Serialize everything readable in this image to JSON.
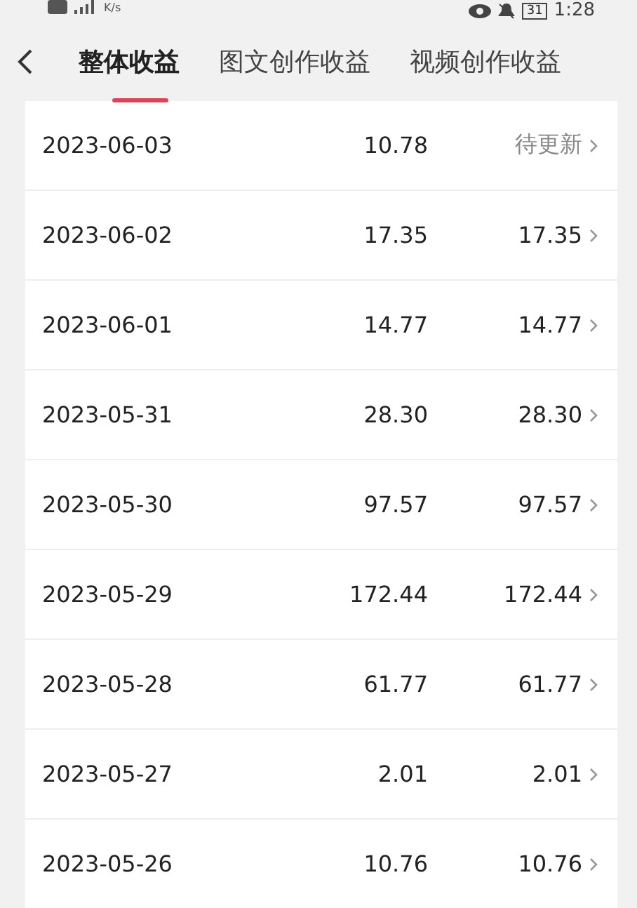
{
  "status_bar": {
    "speed_unit": "K/s",
    "battery": "31",
    "time": "1:28"
  },
  "tabs": [
    {
      "label": "整体收益",
      "selected": true
    },
    {
      "label": "图文创作收益",
      "selected": false
    },
    {
      "label": "视频创作收益",
      "selected": false
    }
  ],
  "rows": [
    {
      "date": "2023-06-03",
      "total": "10.78",
      "settled": "待更新",
      "pending": true
    },
    {
      "date": "2023-06-02",
      "total": "17.35",
      "settled": "17.35",
      "pending": false
    },
    {
      "date": "2023-06-01",
      "total": "14.77",
      "settled": "14.77",
      "pending": false
    },
    {
      "date": "2023-05-31",
      "total": "28.30",
      "settled": "28.30",
      "pending": false
    },
    {
      "date": "2023-05-30",
      "total": "97.57",
      "settled": "97.57",
      "pending": false
    },
    {
      "date": "2023-05-29",
      "total": "172.44",
      "settled": "172.44",
      "pending": false
    },
    {
      "date": "2023-05-28",
      "total": "61.77",
      "settled": "61.77",
      "pending": false
    },
    {
      "date": "2023-05-27",
      "total": "2.01",
      "settled": "2.01",
      "pending": false
    },
    {
      "date": "2023-05-26",
      "total": "10.76",
      "settled": "10.76",
      "pending": false
    }
  ]
}
